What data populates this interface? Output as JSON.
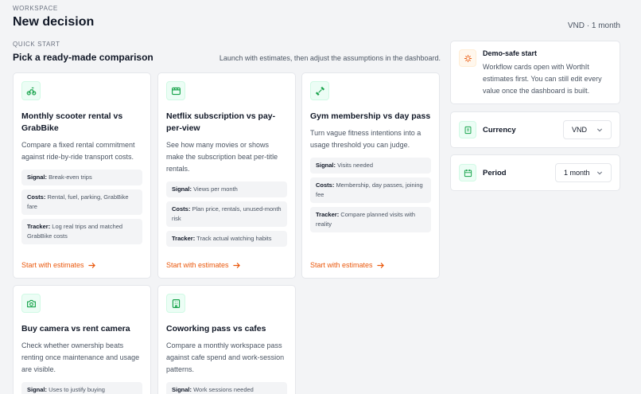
{
  "header": {
    "workspace_label": "WORKSPACE",
    "title": "New decision",
    "meta": "VND · 1 month"
  },
  "quick_start": {
    "label": "QUICK START",
    "title": "Pick a ready-made comparison",
    "hint": "Launch with estimates, then adjust the assumptions in the dashboard."
  },
  "cards": [
    {
      "icon": "scooter-icon",
      "title": "Monthly scooter rental vs GrabBike",
      "desc": "Compare a fixed rental commitment against ride-by-ride transport costs.",
      "signal_key": "Signal:",
      "signal": "Break-even trips",
      "costs_key": "Costs:",
      "costs": "Rental, fuel, parking, GrabBike fare",
      "tracker_key": "Tracker:",
      "tracker": "Log real trips and matched GrabBike costs",
      "cta": "Start with estimates"
    },
    {
      "icon": "film-icon",
      "title": "Netflix subscription vs pay-per-view",
      "desc": "See how many movies or shows make the subscription beat per-title rentals.",
      "signal_key": "Signal:",
      "signal": "Views per month",
      "costs_key": "Costs:",
      "costs": "Plan price, rentals, unused-month risk",
      "tracker_key": "Tracker:",
      "tracker": "Track actual watching habits",
      "cta": "Start with estimates"
    },
    {
      "icon": "dumbbell-icon",
      "title": "Gym membership vs day pass",
      "desc": "Turn vague fitness intentions into a usage threshold you can judge.",
      "signal_key": "Signal:",
      "signal": "Visits needed",
      "costs_key": "Costs:",
      "costs": "Membership, day passes, joining fee",
      "tracker_key": "Tracker:",
      "tracker": "Compare planned visits with reality",
      "cta": "Start with estimates"
    },
    {
      "icon": "camera-icon",
      "title": "Buy camera vs rent camera",
      "desc": "Check whether ownership beats renting once maintenance and usage are visible.",
      "signal_key": "Signal:",
      "signal": "Uses to justify buying"
    },
    {
      "icon": "building-icon",
      "title": "Coworking pass vs cafes",
      "desc": "Compare a monthly workspace pass against cafe spend and work-session patterns.",
      "signal_key": "Signal:",
      "signal": "Work sessions needed"
    }
  ],
  "sidebar": {
    "demo": {
      "title": "Demo-safe start",
      "text": "Workflow cards open with WorthIt estimates first. You can still edit every value once the dashboard is built."
    },
    "currency": {
      "label": "Currency",
      "value": "VND"
    },
    "period": {
      "label": "Period",
      "value": "1 month"
    }
  },
  "colors": {
    "accent": "#ea580c",
    "icon_green": "#16a34a",
    "icon_bg": "#ecfdf5",
    "demo_icon_bg": "#fff7ed"
  }
}
